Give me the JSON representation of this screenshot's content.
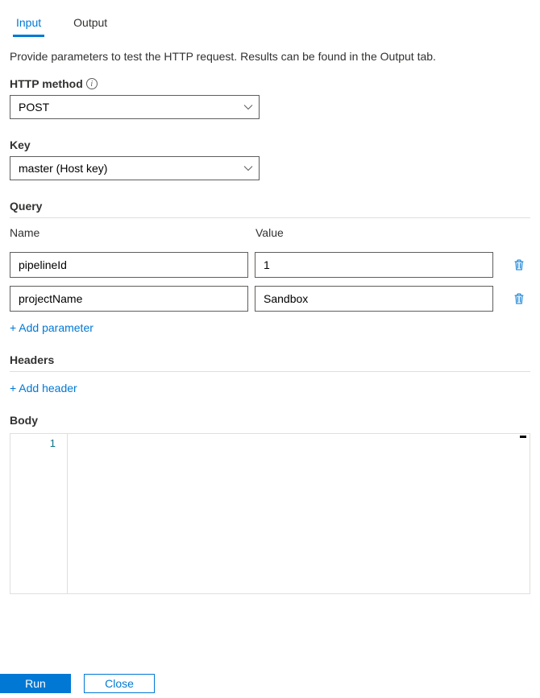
{
  "tabs": {
    "input": "Input",
    "output": "Output"
  },
  "description": "Provide parameters to test the HTTP request. Results can be found in the Output tab.",
  "http_method": {
    "label": "HTTP method",
    "value": "POST"
  },
  "key": {
    "label": "Key",
    "value": "master (Host key)"
  },
  "query": {
    "title": "Query",
    "name_header": "Name",
    "value_header": "Value",
    "params": [
      {
        "name": "pipelineId",
        "value": "1"
      },
      {
        "name": "projectName",
        "value": "Sandbox"
      }
    ],
    "add_label": "+ Add parameter"
  },
  "headers": {
    "title": "Headers",
    "add_label": "+ Add header"
  },
  "body": {
    "title": "Body",
    "line_number": "1"
  },
  "footer": {
    "run": "Run",
    "close": "Close"
  }
}
